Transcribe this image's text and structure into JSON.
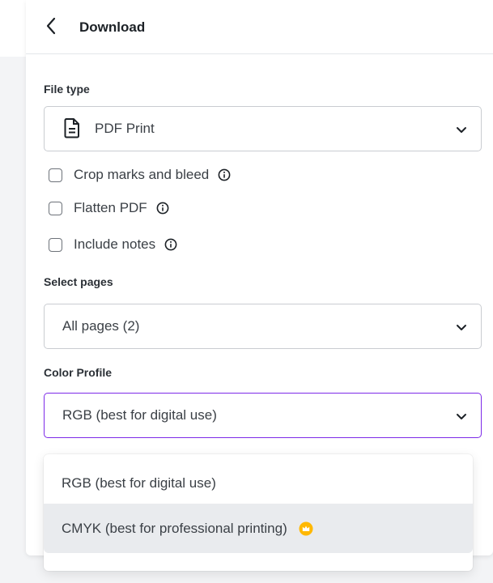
{
  "header": {
    "title": "Download",
    "back_icon": "chevron-left-icon"
  },
  "file_type": {
    "label": "File type",
    "selected": "PDF Print",
    "icon": "file-document-icon"
  },
  "options": [
    {
      "label": "Crop marks and bleed",
      "checked": false
    },
    {
      "label": "Flatten PDF",
      "checked": false
    },
    {
      "label": "Include notes",
      "checked": false
    }
  ],
  "select_pages": {
    "label": "Select pages",
    "selected": "All pages (2)"
  },
  "color_profile": {
    "label": "Color Profile",
    "selected": "RGB (best for digital use)",
    "menu": [
      {
        "label": "RGB (best for digital use)"
      },
      {
        "label": "CMYK (best for professional printing)",
        "badge": "crown-icon",
        "badge_color": "#ffb800"
      }
    ]
  },
  "colors": {
    "accent": "#7d2ae8",
    "premium": "#ffb800"
  }
}
